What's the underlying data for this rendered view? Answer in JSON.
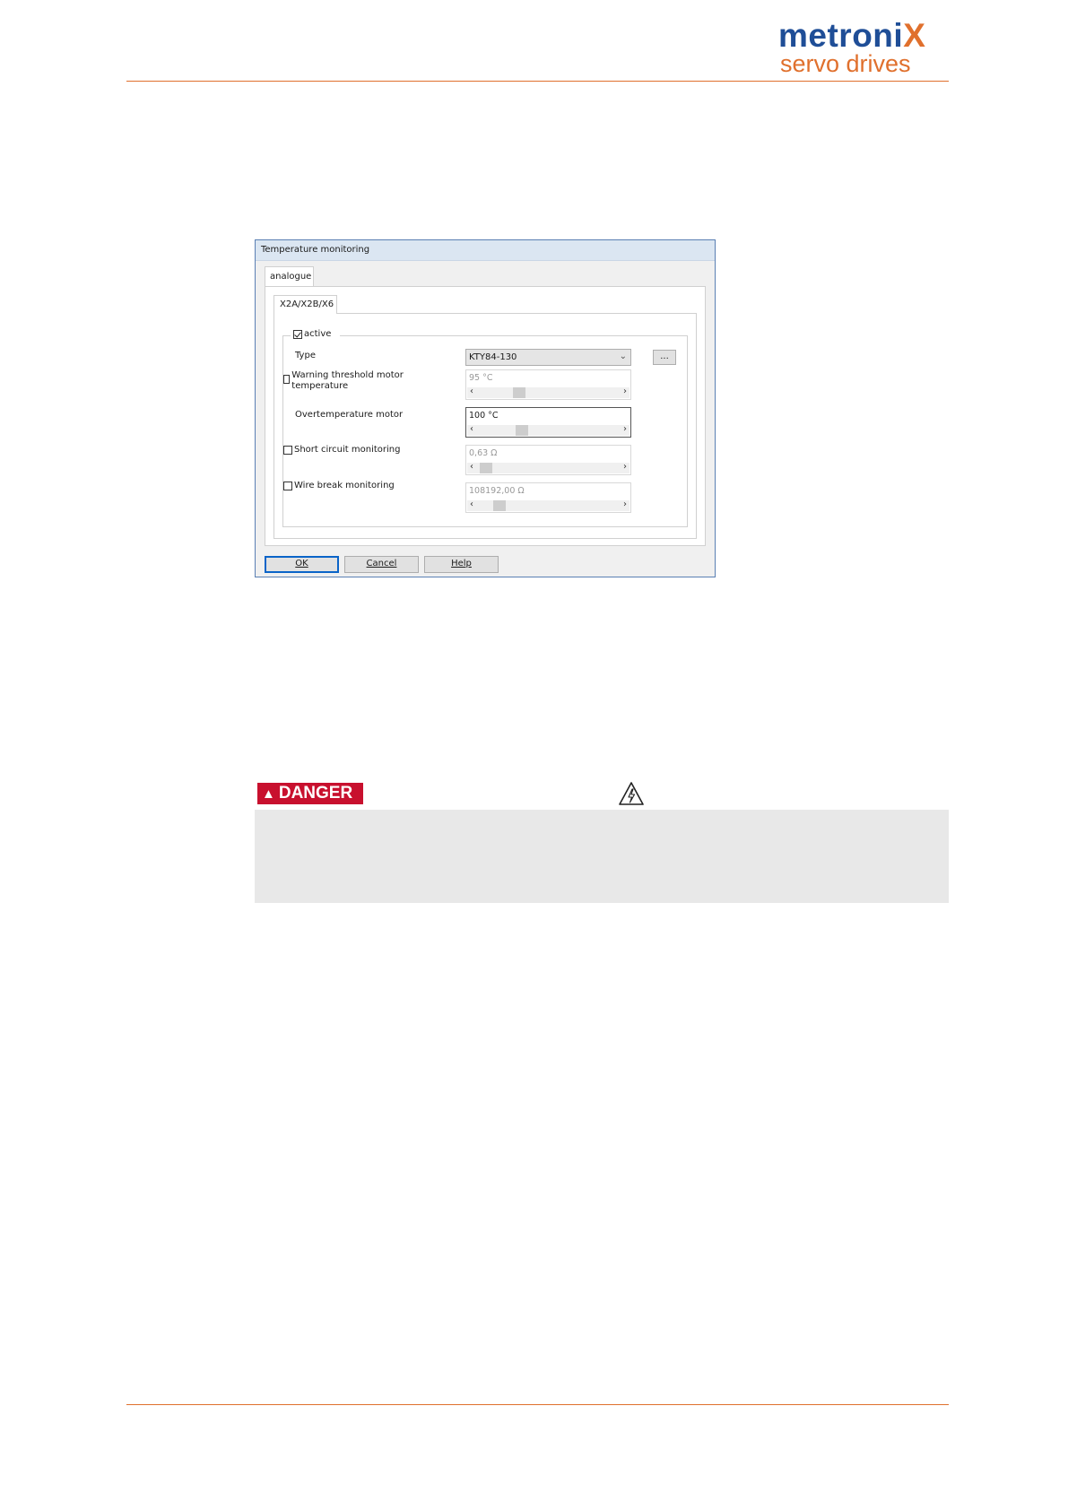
{
  "header": {
    "logo_line1": "metroni",
    "logo_line1_x": "X",
    "logo_line2": "servo drives",
    "brand_color": "#1f4e97",
    "accent_color": "#e0702d"
  },
  "dialog": {
    "title": "Temperature monitoring",
    "outer_tab": "analogue",
    "inner_tab": "X2A/X2B/X6",
    "active_label": "active",
    "active_checked": true,
    "type_label": "Type",
    "type_value": "KTY84-130",
    "dots_button": "...",
    "rows": [
      {
        "label": "Warning threshold motor temperature",
        "checkbox": true,
        "checked": false,
        "value": "95 °C",
        "enabled": false
      },
      {
        "label": "Overtemperature motor",
        "checkbox": false,
        "checked": false,
        "value": "100 °C",
        "enabled": true
      },
      {
        "label": "Short circuit monitoring",
        "checkbox": true,
        "checked": false,
        "value": "0,63 Ω",
        "enabled": false
      },
      {
        "label": "Wire break monitoring",
        "checkbox": true,
        "checked": false,
        "value": "108192,00 Ω",
        "enabled": false
      }
    ],
    "buttons": {
      "ok": "OK",
      "cancel": "Cancel",
      "help": "Help"
    }
  },
  "danger": {
    "label": "DANGER",
    "icon": "high-voltage-warning-icon",
    "color": "#c8102e"
  }
}
